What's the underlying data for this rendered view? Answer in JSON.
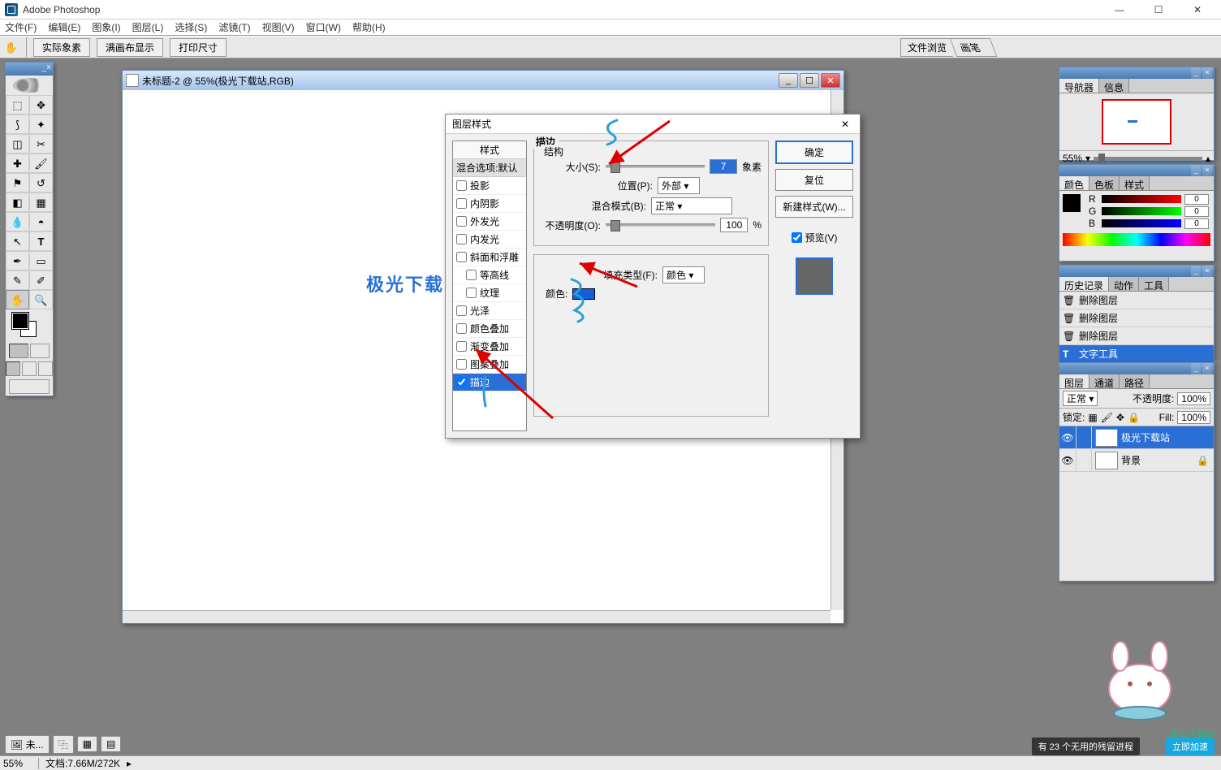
{
  "app": {
    "title": "Adobe Photoshop"
  },
  "menu": [
    "文件(F)",
    "编辑(E)",
    "图象(I)",
    "图层(L)",
    "选择(S)",
    "滤镜(T)",
    "视图(V)",
    "窗口(W)",
    "帮助(H)"
  ],
  "options": {
    "buttons": [
      "实际象素",
      "满画布显示",
      "打印尺寸"
    ],
    "tabs": [
      "文件浏览",
      "画笔"
    ]
  },
  "document": {
    "title": "未标题-2 @ 55%(极光下载站,RGB)",
    "canvas_text": "极光下载"
  },
  "dialog": {
    "title": "图层样式",
    "styles_header": "样式",
    "styles_sub": "混合选项:默认",
    "style_items": [
      {
        "label": "投影",
        "checked": false
      },
      {
        "label": "内阴影",
        "checked": false
      },
      {
        "label": "外发光",
        "checked": false
      },
      {
        "label": "内发光",
        "checked": false
      },
      {
        "label": "斜面和浮雕",
        "checked": false
      },
      {
        "label": "等高线",
        "checked": false,
        "indent": true
      },
      {
        "label": "纹理",
        "checked": false,
        "indent": true
      },
      {
        "label": "光泽",
        "checked": false
      },
      {
        "label": "颜色叠加",
        "checked": false
      },
      {
        "label": "渐变叠加",
        "checked": false
      },
      {
        "label": "图案叠加",
        "checked": false
      },
      {
        "label": "描边",
        "checked": true,
        "selected": true
      }
    ],
    "stroke": {
      "group1": "描边",
      "structure": "结构",
      "size_label": "大小(S):",
      "size_value": "7",
      "size_unit": "象素",
      "position_label": "位置(P):",
      "position_value": "外部",
      "blend_label": "混合模式(B):",
      "blend_value": "正常",
      "opacity_label": "不透明度(O):",
      "opacity_value": "100",
      "opacity_unit": "%",
      "fill_label": "填充类型(F):",
      "fill_value": "颜色",
      "color_label": "颜色:"
    },
    "buttons": {
      "ok": "确定",
      "cancel": "复位",
      "new": "新建样式(W)...",
      "preview": "预览(V)"
    }
  },
  "panels": {
    "navigator": {
      "tabs": [
        "导航器",
        "信息"
      ],
      "zoom": "55%"
    },
    "color": {
      "tabs": [
        "颜色",
        "色板",
        "样式"
      ],
      "r": "0",
      "g": "0",
      "b": "0"
    },
    "history": {
      "tabs": [
        "历史记录",
        "动作",
        "工具"
      ],
      "items": [
        "删除图层",
        "删除图层",
        "删除图层",
        "文字工具"
      ]
    },
    "layers": {
      "tabs": [
        "图层",
        "通道",
        "路径"
      ],
      "mode": "正常",
      "opacity_label": "不透明度:",
      "opacity": "100%",
      "lock_label": "锁定:",
      "fill_label": "Fill:",
      "fill": "100%",
      "items": [
        {
          "name": "极光下载站",
          "type": "T",
          "selected": true
        },
        {
          "name": "背景",
          "type": "bg",
          "locked": true
        }
      ]
    }
  },
  "status": {
    "zoom": "55%",
    "doc": "文档:7.66M/272K"
  },
  "taskbar": {
    "item": "未..."
  },
  "overlay": {
    "notice": "有 23 个无用的残留进程",
    "accel": "立即加速",
    "watermark": "极光下载站"
  }
}
